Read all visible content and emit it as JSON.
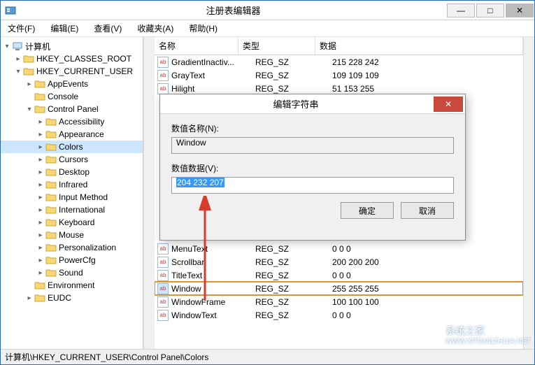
{
  "window": {
    "title": "注册表编辑器"
  },
  "menus": {
    "file": "文件(F)",
    "edit": "编辑(E)",
    "view": "查看(V)",
    "fav": "收藏夹(A)",
    "help": "帮助(H)"
  },
  "tree": {
    "root": "计算机",
    "hkcr": "HKEY_CLASSES_ROOT",
    "hkcu": "HKEY_CURRENT_USER",
    "items": [
      "AppEvents",
      "Console",
      "Control Panel"
    ],
    "cp_children": [
      "Accessibility",
      "Appearance",
      "Colors",
      "Cursors",
      "Desktop",
      "Infrared",
      "Input Method",
      "International",
      "Keyboard",
      "Mouse",
      "Personalization",
      "PowerCfg",
      "Sound"
    ],
    "env": "Environment",
    "eudc": "EUDC"
  },
  "list": {
    "headers": {
      "name": "名称",
      "type": "类型",
      "data": "数据"
    },
    "rows": [
      {
        "name": "GradientInactiv...",
        "type": "REG_SZ",
        "data": "215 228 242"
      },
      {
        "name": "GrayText",
        "type": "REG_SZ",
        "data": "109 109 109"
      },
      {
        "name": "Hilight",
        "type": "REG_SZ",
        "data": "51 153 255"
      },
      {
        "name": "MenuText",
        "type": "REG_SZ",
        "data": "0 0 0"
      },
      {
        "name": "Scrollbar",
        "type": "REG_SZ",
        "data": "200 200 200"
      },
      {
        "name": "TitleText",
        "type": "REG_SZ",
        "data": "0 0 0"
      },
      {
        "name": "Window",
        "type": "REG_SZ",
        "data": "255 255 255",
        "sel": true
      },
      {
        "name": "WindowFrame",
        "type": "REG_SZ",
        "data": "100 100 100"
      },
      {
        "name": "WindowText",
        "type": "REG_SZ",
        "data": "0 0 0"
      }
    ]
  },
  "dialog": {
    "title": "编辑字符串",
    "name_label": "数值名称(N):",
    "name_value": "Window",
    "data_label": "数值数据(V):",
    "data_value": "204 232 207",
    "ok": "确定",
    "cancel": "取消"
  },
  "status": {
    "path": "计算机\\HKEY_CURRENT_USER\\Control Panel\\Colors"
  },
  "watermark": {
    "name": "系统之家",
    "url": "WWW.XITONGZHIJIA.NET"
  }
}
